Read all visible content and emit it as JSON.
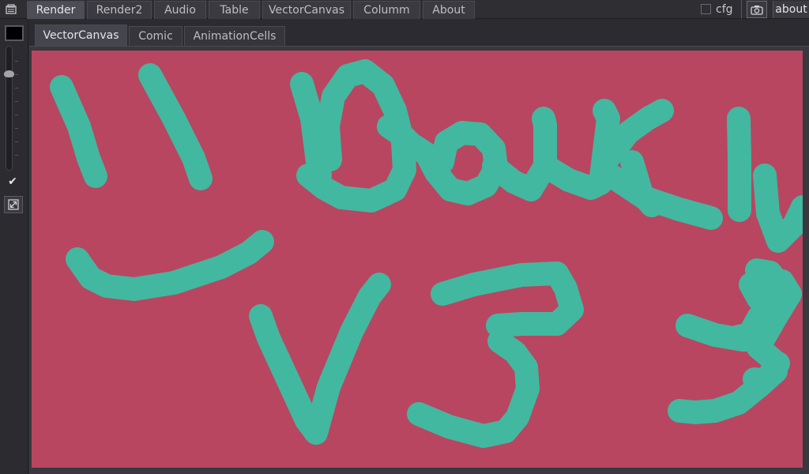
{
  "menu": {
    "tabs": [
      {
        "label": "Render"
      },
      {
        "label": "Render2"
      },
      {
        "label": "Audio"
      },
      {
        "label": "Table"
      },
      {
        "label": "VectorCanvas"
      },
      {
        "label": "Columm"
      },
      {
        "label": "About"
      }
    ],
    "active_tab": "Render",
    "cfg_label": "cfg",
    "cfg_checked": false,
    "about_label": "about"
  },
  "subtabs": {
    "tabs": [
      {
        "label": "VectorCanvas"
      },
      {
        "label": "Comic"
      },
      {
        "label": "AnimationCells"
      }
    ],
    "active_tab": "VectorCanvas"
  },
  "toolbar": {
    "current_color": "#000000",
    "check_glyph": "✔",
    "check_checked": true
  },
  "canvas": {
    "background_color": "#b84660",
    "stroke_color": "#42b8a0"
  }
}
